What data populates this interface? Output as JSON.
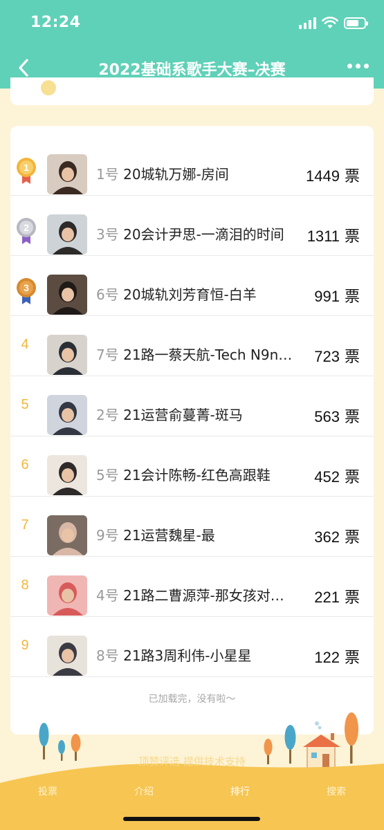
{
  "status_bar": {
    "time": "12:24"
  },
  "nav": {
    "title": "2022基础系歌手大赛–决赛"
  },
  "ranking": [
    {
      "rank": "1",
      "number": "1号",
      "title": "20城轨万娜-房间",
      "votes": "1449",
      "unit": "票",
      "medal": "gold"
    },
    {
      "rank": "2",
      "number": "3号",
      "title": "20会计尹思-一滴泪的时间",
      "votes": "1311",
      "unit": "票",
      "medal": "silver"
    },
    {
      "rank": "3",
      "number": "6号",
      "title": "20城轨刘芳育恒-白羊",
      "votes": "991",
      "unit": "票",
      "medal": "bronze"
    },
    {
      "rank": "4",
      "number": "7号",
      "title": "21路一蔡天航-Tech N9ne…",
      "votes": "723",
      "unit": "票"
    },
    {
      "rank": "5",
      "number": "2号",
      "title": "21运营俞蔓菁-斑马",
      "votes": "563",
      "unit": "票"
    },
    {
      "rank": "6",
      "number": "5号",
      "title": "21会计陈畅-红色高跟鞋",
      "votes": "452",
      "unit": "票"
    },
    {
      "rank": "7",
      "number": "9号",
      "title": "21运营魏星-最",
      "votes": "362",
      "unit": "票"
    },
    {
      "rank": "8",
      "number": "4号",
      "title": "21路二曹源萍-那女孩对…",
      "votes": "221",
      "unit": "票"
    },
    {
      "rank": "9",
      "number": "8号",
      "title": "21路3周利伟-小星星",
      "votes": "122",
      "unit": "票"
    }
  ],
  "list_end_text": "已加载完，没有啦～",
  "credit": "顶赞评选 提供技术支持",
  "tabs": [
    {
      "label": "投票"
    },
    {
      "label": "介绍"
    },
    {
      "label": "排行",
      "active": true
    },
    {
      "label": "搜索"
    }
  ],
  "colors": {
    "header": "#5fd1b8",
    "background": "#fdf3d6",
    "rank_number": "#f0b73e",
    "tabbar": "#f6c552"
  }
}
